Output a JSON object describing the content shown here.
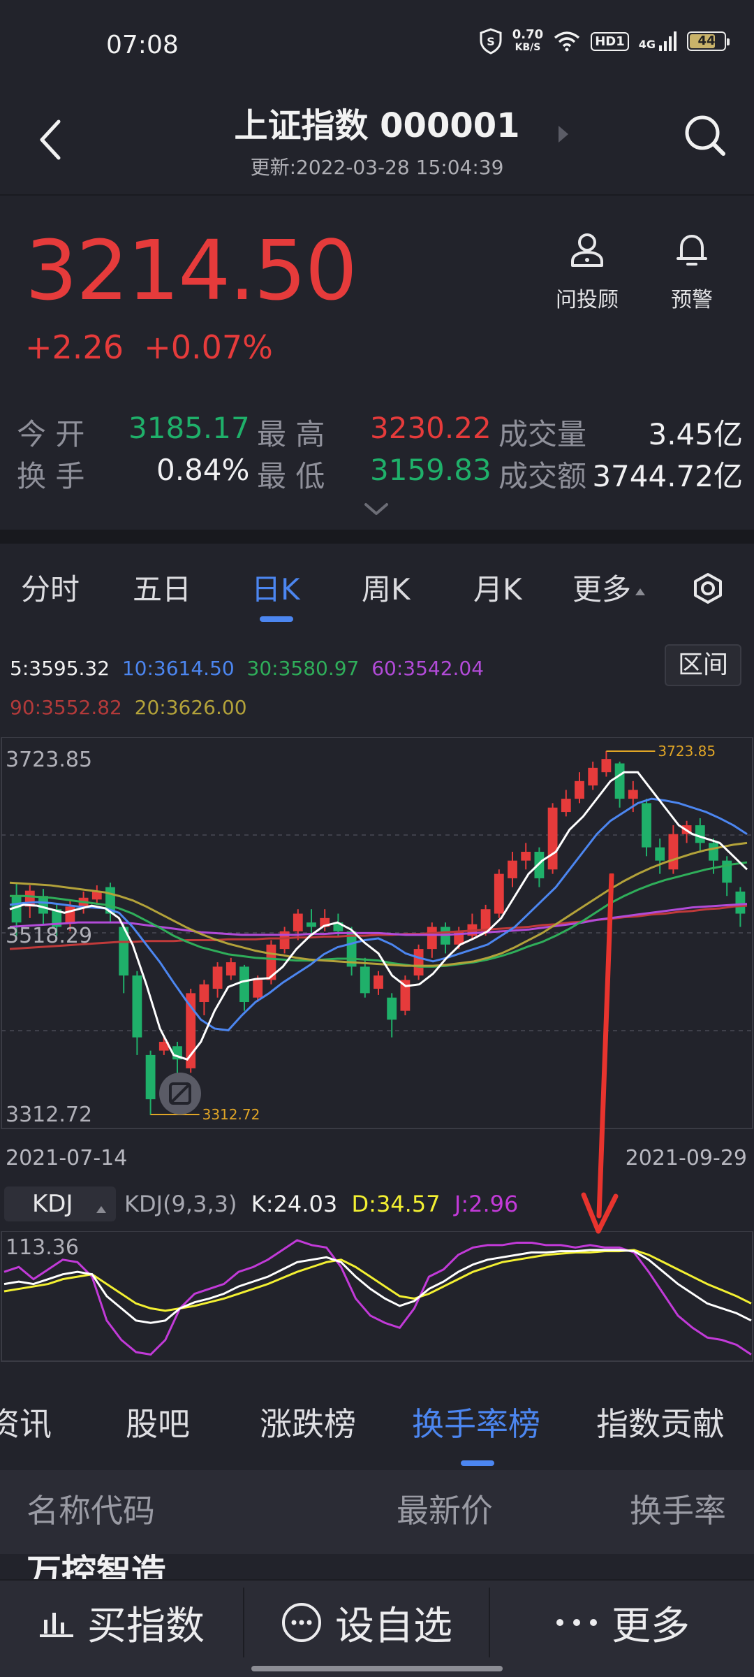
{
  "status_bar": {
    "time": "07:08",
    "speed_value": "0.70",
    "speed_unit": "KB/S",
    "hd": "HD1",
    "network": "4G",
    "battery": "44"
  },
  "header": {
    "title": "上证指数 000001",
    "updated": "更新:2022-03-28 15:04:39"
  },
  "quote": {
    "price": "3214.50",
    "change": "+2.26",
    "change_pct": "+0.07%",
    "advisor_label": "问投顾",
    "alert_label": "预警"
  },
  "stats": {
    "open_label": "今 开",
    "open": "3185.17",
    "high_label": "最 高",
    "high": "3230.22",
    "volume_label": "成交量",
    "volume": "3.45亿",
    "turnover_label": "换 手",
    "turnover": "0.84%",
    "low_label": "最 低",
    "low": "3159.83",
    "amount_label": "成交额",
    "amount": "3744.72亿"
  },
  "chart_tabs": [
    "分时",
    "五日",
    "日K",
    "周K",
    "月K",
    "更多"
  ],
  "ma": {
    "ma5": "5:3595.32",
    "ma10": "10:3614.50",
    "ma30": "30:3580.97",
    "ma60": "60:3542.04",
    "ma90": "90:3552.82",
    "ma20": "20:3626.00",
    "interval_label": "区间"
  },
  "colors": {
    "up": "#e63b3b",
    "down": "#1fb06a",
    "accent": "#4c86f0",
    "ma5": "#ffffff",
    "ma10": "#4c86f0",
    "ma30": "#2fae5a",
    "ma60": "#b24bd8",
    "ma90": "#c03a3a",
    "ma20": "#b3a23a",
    "k": "#ffffff",
    "d": "#f3f032",
    "j": "#c23ad8"
  },
  "chart_data": {
    "type": "candlestick",
    "x_start": "2021-07-14",
    "x_end": "2021-09-29",
    "ylim": [
      3312.72,
      3723.85
    ],
    "y_ticks": [
      "3723.85",
      "3518.29",
      "3312.72"
    ],
    "high_marker": "3723.85",
    "low_marker": "3312.72",
    "candles": [
      {
        "o": 3560,
        "c": 3530,
        "h": 3575,
        "l": 3515
      },
      {
        "o": 3548,
        "c": 3566,
        "h": 3572,
        "l": 3535
      },
      {
        "o": 3560,
        "c": 3540,
        "h": 3568,
        "l": 3528
      },
      {
        "o": 3545,
        "c": 3525,
        "h": 3550,
        "l": 3515
      },
      {
        "o": 3530,
        "c": 3548,
        "h": 3555,
        "l": 3520
      },
      {
        "o": 3548,
        "c": 3558,
        "h": 3565,
        "l": 3540
      },
      {
        "o": 3556,
        "c": 3565,
        "h": 3572,
        "l": 3550
      },
      {
        "o": 3570,
        "c": 3540,
        "h": 3575,
        "l": 3530
      },
      {
        "o": 3525,
        "c": 3470,
        "h": 3530,
        "l": 3450
      },
      {
        "o": 3470,
        "c": 3400,
        "h": 3475,
        "l": 3380
      },
      {
        "o": 3380,
        "c": 3330,
        "h": 3385,
        "l": 3312
      },
      {
        "o": 3385,
        "c": 3395,
        "h": 3400,
        "l": 3380
      },
      {
        "o": 3390,
        "c": 3375,
        "h": 3395,
        "l": 3345
      },
      {
        "o": 3365,
        "c": 3450,
        "h": 3455,
        "l": 3360
      },
      {
        "o": 3440,
        "c": 3460,
        "h": 3465,
        "l": 3425
      },
      {
        "o": 3455,
        "c": 3480,
        "h": 3485,
        "l": 3445
      },
      {
        "o": 3470,
        "c": 3485,
        "h": 3490,
        "l": 3465
      },
      {
        "o": 3480,
        "c": 3440,
        "h": 3482,
        "l": 3430
      },
      {
        "o": 3445,
        "c": 3465,
        "h": 3470,
        "l": 3440
      },
      {
        "o": 3465,
        "c": 3505,
        "h": 3510,
        "l": 3460
      },
      {
        "o": 3500,
        "c": 3520,
        "h": 3525,
        "l": 3495
      },
      {
        "o": 3520,
        "c": 3540,
        "h": 3545,
        "l": 3510
      },
      {
        "o": 3530,
        "c": 3525,
        "h": 3545,
        "l": 3515
      },
      {
        "o": 3525,
        "c": 3535,
        "h": 3545,
        "l": 3520
      },
      {
        "o": 3530,
        "c": 3520,
        "h": 3540,
        "l": 3515
      },
      {
        "o": 3520,
        "c": 3480,
        "h": 3525,
        "l": 3470
      },
      {
        "o": 3480,
        "c": 3450,
        "h": 3490,
        "l": 3445
      },
      {
        "o": 3455,
        "c": 3470,
        "h": 3475,
        "l": 3448
      },
      {
        "o": 3445,
        "c": 3420,
        "h": 3450,
        "l": 3400
      },
      {
        "o": 3430,
        "c": 3465,
        "h": 3470,
        "l": 3425
      },
      {
        "o": 3470,
        "c": 3500,
        "h": 3505,
        "l": 3465
      },
      {
        "o": 3500,
        "c": 3525,
        "h": 3530,
        "l": 3490
      },
      {
        "o": 3525,
        "c": 3505,
        "h": 3530,
        "l": 3495
      },
      {
        "o": 3505,
        "c": 3520,
        "h": 3525,
        "l": 3500
      },
      {
        "o": 3515,
        "c": 3528,
        "h": 3540,
        "l": 3510
      },
      {
        "o": 3520,
        "c": 3545,
        "h": 3550,
        "l": 3515
      },
      {
        "o": 3540,
        "c": 3585,
        "h": 3590,
        "l": 3535
      },
      {
        "o": 3580,
        "c": 3600,
        "h": 3610,
        "l": 3570
      },
      {
        "o": 3600,
        "c": 3610,
        "h": 3620,
        "l": 3590
      },
      {
        "o": 3610,
        "c": 3580,
        "h": 3615,
        "l": 3570
      },
      {
        "o": 3590,
        "c": 3660,
        "h": 3665,
        "l": 3585
      },
      {
        "o": 3655,
        "c": 3670,
        "h": 3680,
        "l": 3650
      },
      {
        "o": 3670,
        "c": 3690,
        "h": 3700,
        "l": 3665
      },
      {
        "o": 3685,
        "c": 3705,
        "h": 3712,
        "l": 3680
      },
      {
        "o": 3700,
        "c": 3715,
        "h": 3724,
        "l": 3695
      },
      {
        "o": 3710,
        "c": 3670,
        "h": 3712,
        "l": 3660
      },
      {
        "o": 3670,
        "c": 3680,
        "h": 3690,
        "l": 3655
      },
      {
        "o": 3665,
        "c": 3615,
        "h": 3670,
        "l": 3605
      },
      {
        "o": 3615,
        "c": 3600,
        "h": 3625,
        "l": 3585
      },
      {
        "o": 3590,
        "c": 3630,
        "h": 3640,
        "l": 3585
      },
      {
        "o": 3630,
        "c": 3640,
        "h": 3645,
        "l": 3620
      },
      {
        "o": 3640,
        "c": 3620,
        "h": 3648,
        "l": 3610
      },
      {
        "o": 3620,
        "c": 3600,
        "h": 3625,
        "l": 3585
      },
      {
        "o": 3600,
        "c": 3575,
        "h": 3605,
        "l": 3560
      },
      {
        "o": 3565,
        "c": 3540,
        "h": 3570,
        "l": 3525
      }
    ],
    "ma5": [
      3545,
      3550,
      3549,
      3545,
      3541,
      3545,
      3549,
      3546,
      3535,
      3505,
      3460,
      3410,
      3380,
      3375,
      3395,
      3430,
      3457,
      3463,
      3466,
      3467,
      3480,
      3500,
      3515,
      3526,
      3530,
      3522,
      3507,
      3495,
      3470,
      3458,
      3460,
      3472,
      3490,
      3505,
      3512,
      3520,
      3535,
      3560,
      3585,
      3600,
      3610,
      3635,
      3650,
      3670,
      3690,
      3700,
      3700,
      3680,
      3660,
      3640,
      3630,
      3625,
      3620,
      3605,
      3590
    ],
    "ma10": [
      3550,
      3552,
      3553,
      3552,
      3550,
      3548,
      3547,
      3546,
      3541,
      3525,
      3505,
      3485,
      3462,
      3440,
      3420,
      3410,
      3408,
      3425,
      3440,
      3450,
      3462,
      3472,
      3482,
      3494,
      3502,
      3506,
      3510,
      3512,
      3505,
      3495,
      3490,
      3486,
      3490,
      3495,
      3500,
      3505,
      3515,
      3525,
      3540,
      3555,
      3570,
      3590,
      3610,
      3630,
      3645,
      3655,
      3665,
      3670,
      3668,
      3665,
      3660,
      3655,
      3648,
      3640,
      3630
    ],
    "ma30": [
      3560,
      3560,
      3559,
      3558,
      3556,
      3554,
      3552,
      3550,
      3546,
      3540,
      3532,
      3524,
      3515,
      3508,
      3502,
      3498,
      3494,
      3492,
      3490,
      3489,
      3488,
      3487,
      3487,
      3488,
      3489,
      3489,
      3488,
      3487,
      3484,
      3482,
      3480,
      3480,
      3481,
      3483,
      3485,
      3488,
      3492,
      3497,
      3503,
      3508,
      3515,
      3523,
      3532,
      3542,
      3552,
      3560,
      3567,
      3573,
      3578,
      3582,
      3586,
      3590,
      3593,
      3596,
      3598
    ],
    "ma60": [
      3525,
      3526,
      3527,
      3528,
      3529,
      3530,
      3530,
      3530,
      3530,
      3529,
      3527,
      3525,
      3523,
      3521,
      3519,
      3518,
      3517,
      3516,
      3516,
      3516,
      3516,
      3516,
      3517,
      3517,
      3518,
      3518,
      3518,
      3518,
      3517,
      3516,
      3516,
      3516,
      3516,
      3517,
      3518,
      3519,
      3520,
      3521,
      3522,
      3524,
      3526,
      3528,
      3530,
      3533,
      3535,
      3537,
      3539,
      3541,
      3543,
      3545,
      3547,
      3548,
      3549,
      3550,
      3551
    ],
    "ma90": [
      3500,
      3501,
      3502,
      3503,
      3504,
      3505,
      3506,
      3507,
      3508,
      3508,
      3509,
      3509,
      3509,
      3510,
      3510,
      3510,
      3511,
      3511,
      3511,
      3512,
      3512,
      3513,
      3513,
      3514,
      3514,
      3515,
      3515,
      3516,
      3516,
      3517,
      3517,
      3518,
      3519,
      3520,
      3521,
      3522,
      3523,
      3524,
      3525,
      3527,
      3528,
      3530,
      3531,
      3533,
      3534,
      3536,
      3537,
      3539,
      3540,
      3542,
      3543,
      3545,
      3546,
      3548,
      3549
    ],
    "ma20": [
      3575,
      3574,
      3573,
      3572,
      3570,
      3568,
      3566,
      3564,
      3560,
      3555,
      3548,
      3540,
      3532,
      3524,
      3517,
      3511,
      3506,
      3502,
      3498,
      3495,
      3493,
      3490,
      3488,
      3487,
      3486,
      3485,
      3484,
      3483,
      3482,
      3481,
      3481,
      3481,
      3482,
      3484,
      3486,
      3490,
      3495,
      3502,
      3510,
      3518,
      3528,
      3538,
      3548,
      3558,
      3568,
      3577,
      3585,
      3592,
      3598,
      3603,
      3608,
      3612,
      3615,
      3618,
      3620
    ],
    "kdj": {
      "label": "KDJ",
      "params": "KDJ(9,3,3)",
      "k_text": "K:24.03",
      "d_text": "D:34.57",
      "j_text": "J:2.96",
      "ymax_label": "113.36",
      "k": [
        60,
        62,
        60,
        64,
        68,
        70,
        68,
        50,
        40,
        30,
        28,
        30,
        40,
        45,
        48,
        52,
        58,
        62,
        66,
        72,
        78,
        80,
        82,
        78,
        66,
        56,
        48,
        42,
        46,
        56,
        62,
        70,
        76,
        80,
        82,
        84,
        86,
        86,
        87,
        87,
        88,
        88,
        88,
        87,
        80,
        70,
        60,
        52,
        44,
        40,
        36,
        30
      ],
      "d": [
        54,
        56,
        58,
        60,
        64,
        66,
        68,
        60,
        52,
        44,
        40,
        38,
        40,
        42,
        45,
        48,
        52,
        56,
        60,
        65,
        70,
        74,
        78,
        80,
        74,
        66,
        58,
        50,
        48,
        52,
        58,
        64,
        70,
        74,
        78,
        80,
        82,
        84,
        85,
        86,
        86,
        87,
        87,
        88,
        84,
        78,
        72,
        66,
        60,
        55,
        50,
        44
      ],
      "j": [
        70,
        74,
        64,
        72,
        80,
        78,
        66,
        30,
        14,
        4,
        2,
        14,
        40,
        52,
        56,
        60,
        70,
        74,
        80,
        88,
        96,
        92,
        90,
        74,
        48,
        34,
        28,
        24,
        40,
        66,
        72,
        84,
        90,
        92,
        92,
        94,
        94,
        92,
        92,
        90,
        92,
        90,
        90,
        86,
        70,
        52,
        34,
        24,
        16,
        14,
        10,
        2
      ]
    }
  },
  "lower_tabs": [
    "资讯",
    "股吧",
    "涨跌榜",
    "换手率榜",
    "指数贡献"
  ],
  "table": {
    "col_name": "名称代码",
    "col_price": "最新价",
    "col_turnover": "换手率",
    "first_row_name": "万控智造"
  },
  "bottom_bar": {
    "buy": "买指数",
    "watch": "设自选",
    "more": "更多"
  }
}
